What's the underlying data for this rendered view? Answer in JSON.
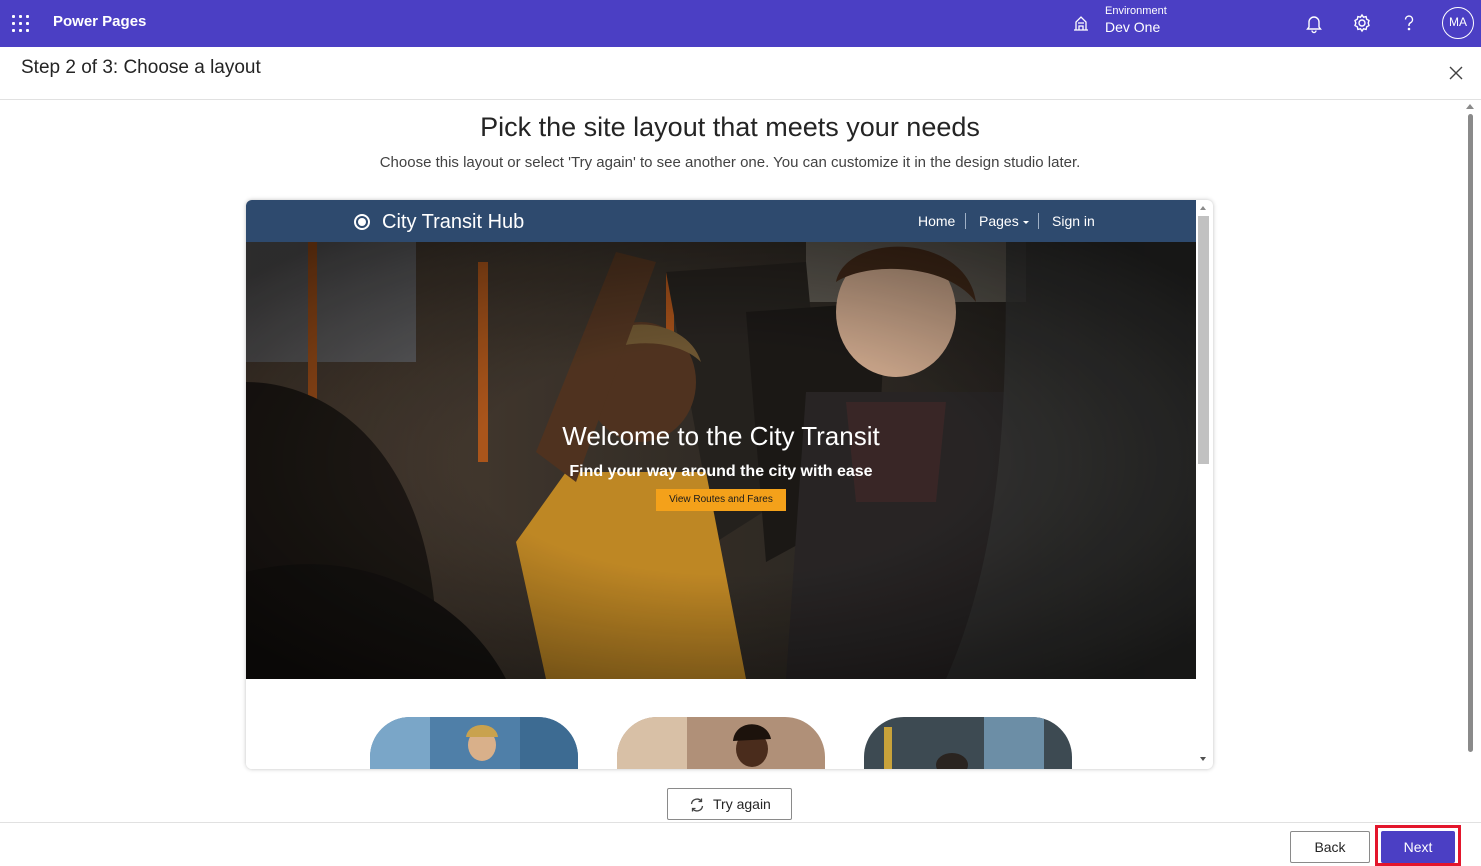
{
  "app": {
    "title": "Power Pages",
    "environment_label": "Environment",
    "environment_name": "Dev One",
    "avatar_initials": "MA",
    "brand_color": "#4b3fc4"
  },
  "wizard": {
    "step_title": "Step 2 of 3: Choose a layout",
    "heading": "Pick the site layout that meets your needs",
    "subheading": "Choose this layout or select 'Try again' to see another one. You can customize it in the design studio later.",
    "try_again_label": "Try again",
    "back_label": "Back",
    "next_label": "Next"
  },
  "preview": {
    "site_name": "City Transit Hub",
    "nav": [
      "Home",
      "Pages",
      "Sign in"
    ],
    "hero_title": "Welcome to the City Transit",
    "hero_subtitle": "Find your way around the city with ease",
    "hero_button": "View Routes and Fares",
    "nav_color": "#2e4a6e",
    "button_color": "#f4a11a"
  },
  "icons": [
    "app-launcher-icon",
    "environment-icon",
    "bell-icon",
    "gear-icon",
    "help-icon",
    "close-icon",
    "refresh-icon"
  ]
}
